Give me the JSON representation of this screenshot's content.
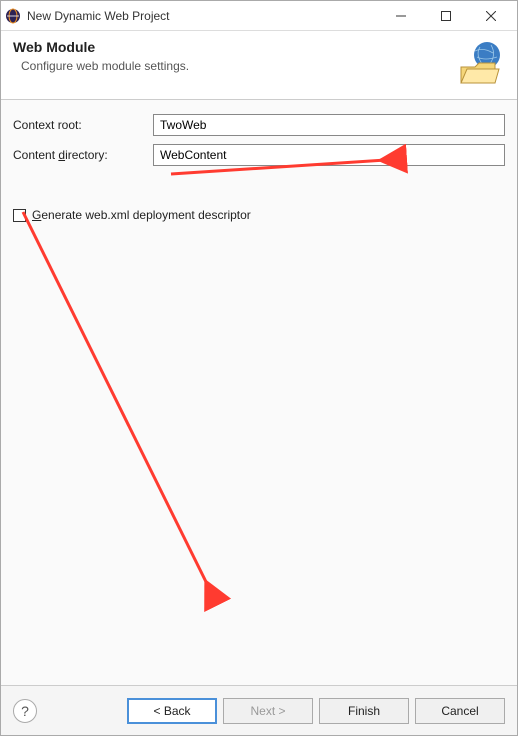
{
  "window": {
    "title": "New Dynamic Web Project"
  },
  "header": {
    "title": "Web Module",
    "subtitle": "Configure web module settings."
  },
  "form": {
    "context_root_label": "Context root:",
    "context_root_value": "TwoWeb",
    "content_dir_label": "Content directory:",
    "content_dir_value": "WebContent",
    "generate_checkbox_label_pre": "G",
    "generate_checkbox_label_post": "enerate web.xml deployment descriptor"
  },
  "footer": {
    "help": "?",
    "back": "< Back",
    "next": "Next >",
    "finish": "Finish",
    "cancel": "Cancel"
  }
}
